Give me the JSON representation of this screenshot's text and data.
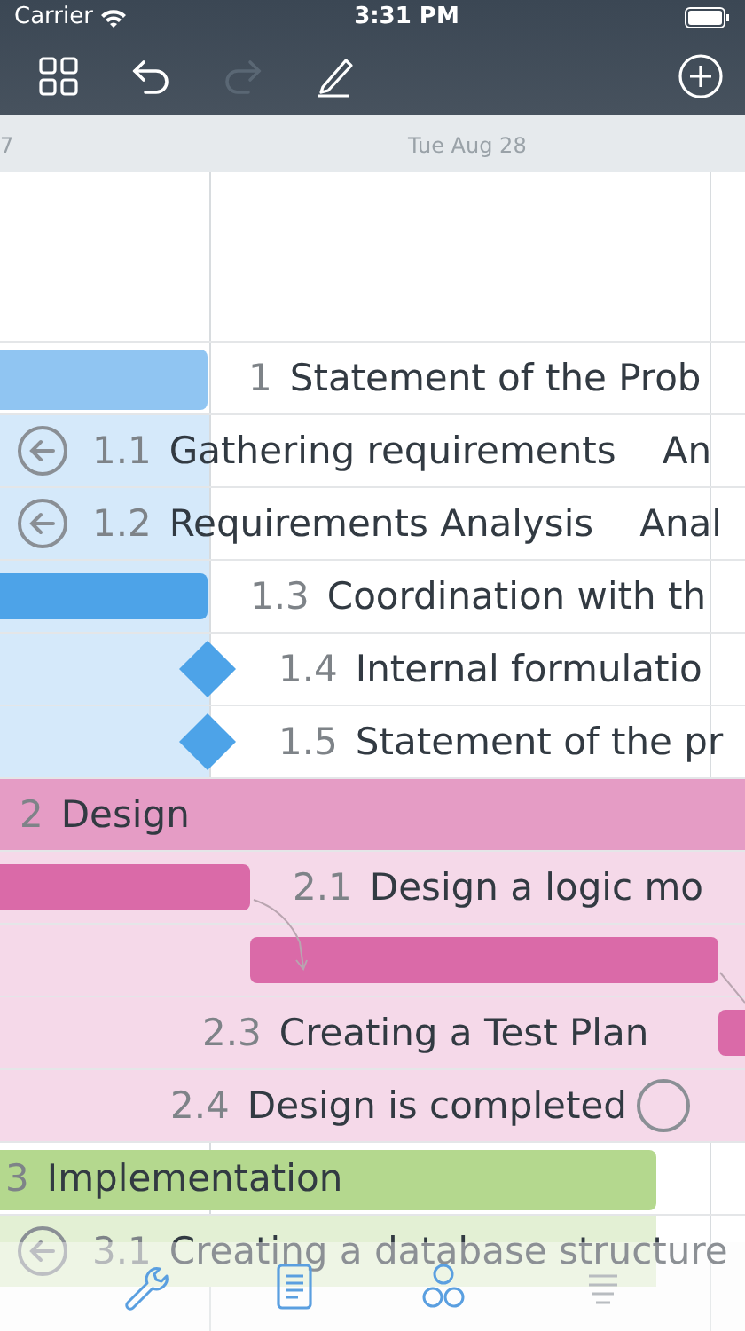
{
  "status_bar": {
    "carrier": "Carrier",
    "time": "3:31 PM"
  },
  "toolbar": [
    {
      "kind": "grid",
      "disabled": false
    },
    {
      "kind": "undo",
      "disabled": false
    },
    {
      "kind": "redo",
      "disabled": true
    },
    {
      "kind": "pencil",
      "disabled": false
    },
    {
      "kind": "add",
      "disabled": false
    }
  ],
  "timeline": {
    "dates": [
      "7",
      "Tue Aug 28"
    ]
  },
  "groups": [
    {
      "number": "1",
      "title": "Statement of the Prob",
      "color": "#90c5f2",
      "tasks": [
        {
          "number": "1.1",
          "title": "Gathering requirements",
          "resource": "An",
          "kind": "link"
        },
        {
          "number": "1.2",
          "title": "Requirements Analysis",
          "resource": "Anal",
          "kind": "link"
        },
        {
          "number": "1.3",
          "title": "Coordination with th",
          "kind": "task",
          "color": "#4da3e8"
        },
        {
          "number": "1.4",
          "title": "Internal formulatio",
          "kind": "milestone",
          "color": "#4da3e8"
        },
        {
          "number": "1.5",
          "title": "Statement of the pr",
          "kind": "milestone",
          "color": "#4da3e8"
        }
      ]
    },
    {
      "number": "2",
      "title": "Design",
      "color": "#e59cc5",
      "tasks": [
        {
          "number": "2.1",
          "title": "Design a logic mo",
          "kind": "task",
          "color": "#da6aa8"
        },
        {
          "kind": "task",
          "color": "#da6aa8"
        },
        {
          "number": "2.3",
          "title": "Creating a Test Plan",
          "kind": "task",
          "color": "#da6aa8"
        },
        {
          "number": "2.4",
          "title": "Design is completed",
          "kind": "done"
        }
      ]
    },
    {
      "number": "3",
      "title": "Implementation",
      "color": "#b4d88e",
      "tasks": [
        {
          "number": "3.1",
          "title": "Creating a database structure",
          "kind": "link"
        }
      ]
    }
  ],
  "tab_bar": [
    {
      "kind": "wrench",
      "selected": false
    },
    {
      "kind": "document",
      "selected": false
    },
    {
      "kind": "circles",
      "selected": false
    },
    {
      "kind": "lines",
      "selected": false
    }
  ]
}
